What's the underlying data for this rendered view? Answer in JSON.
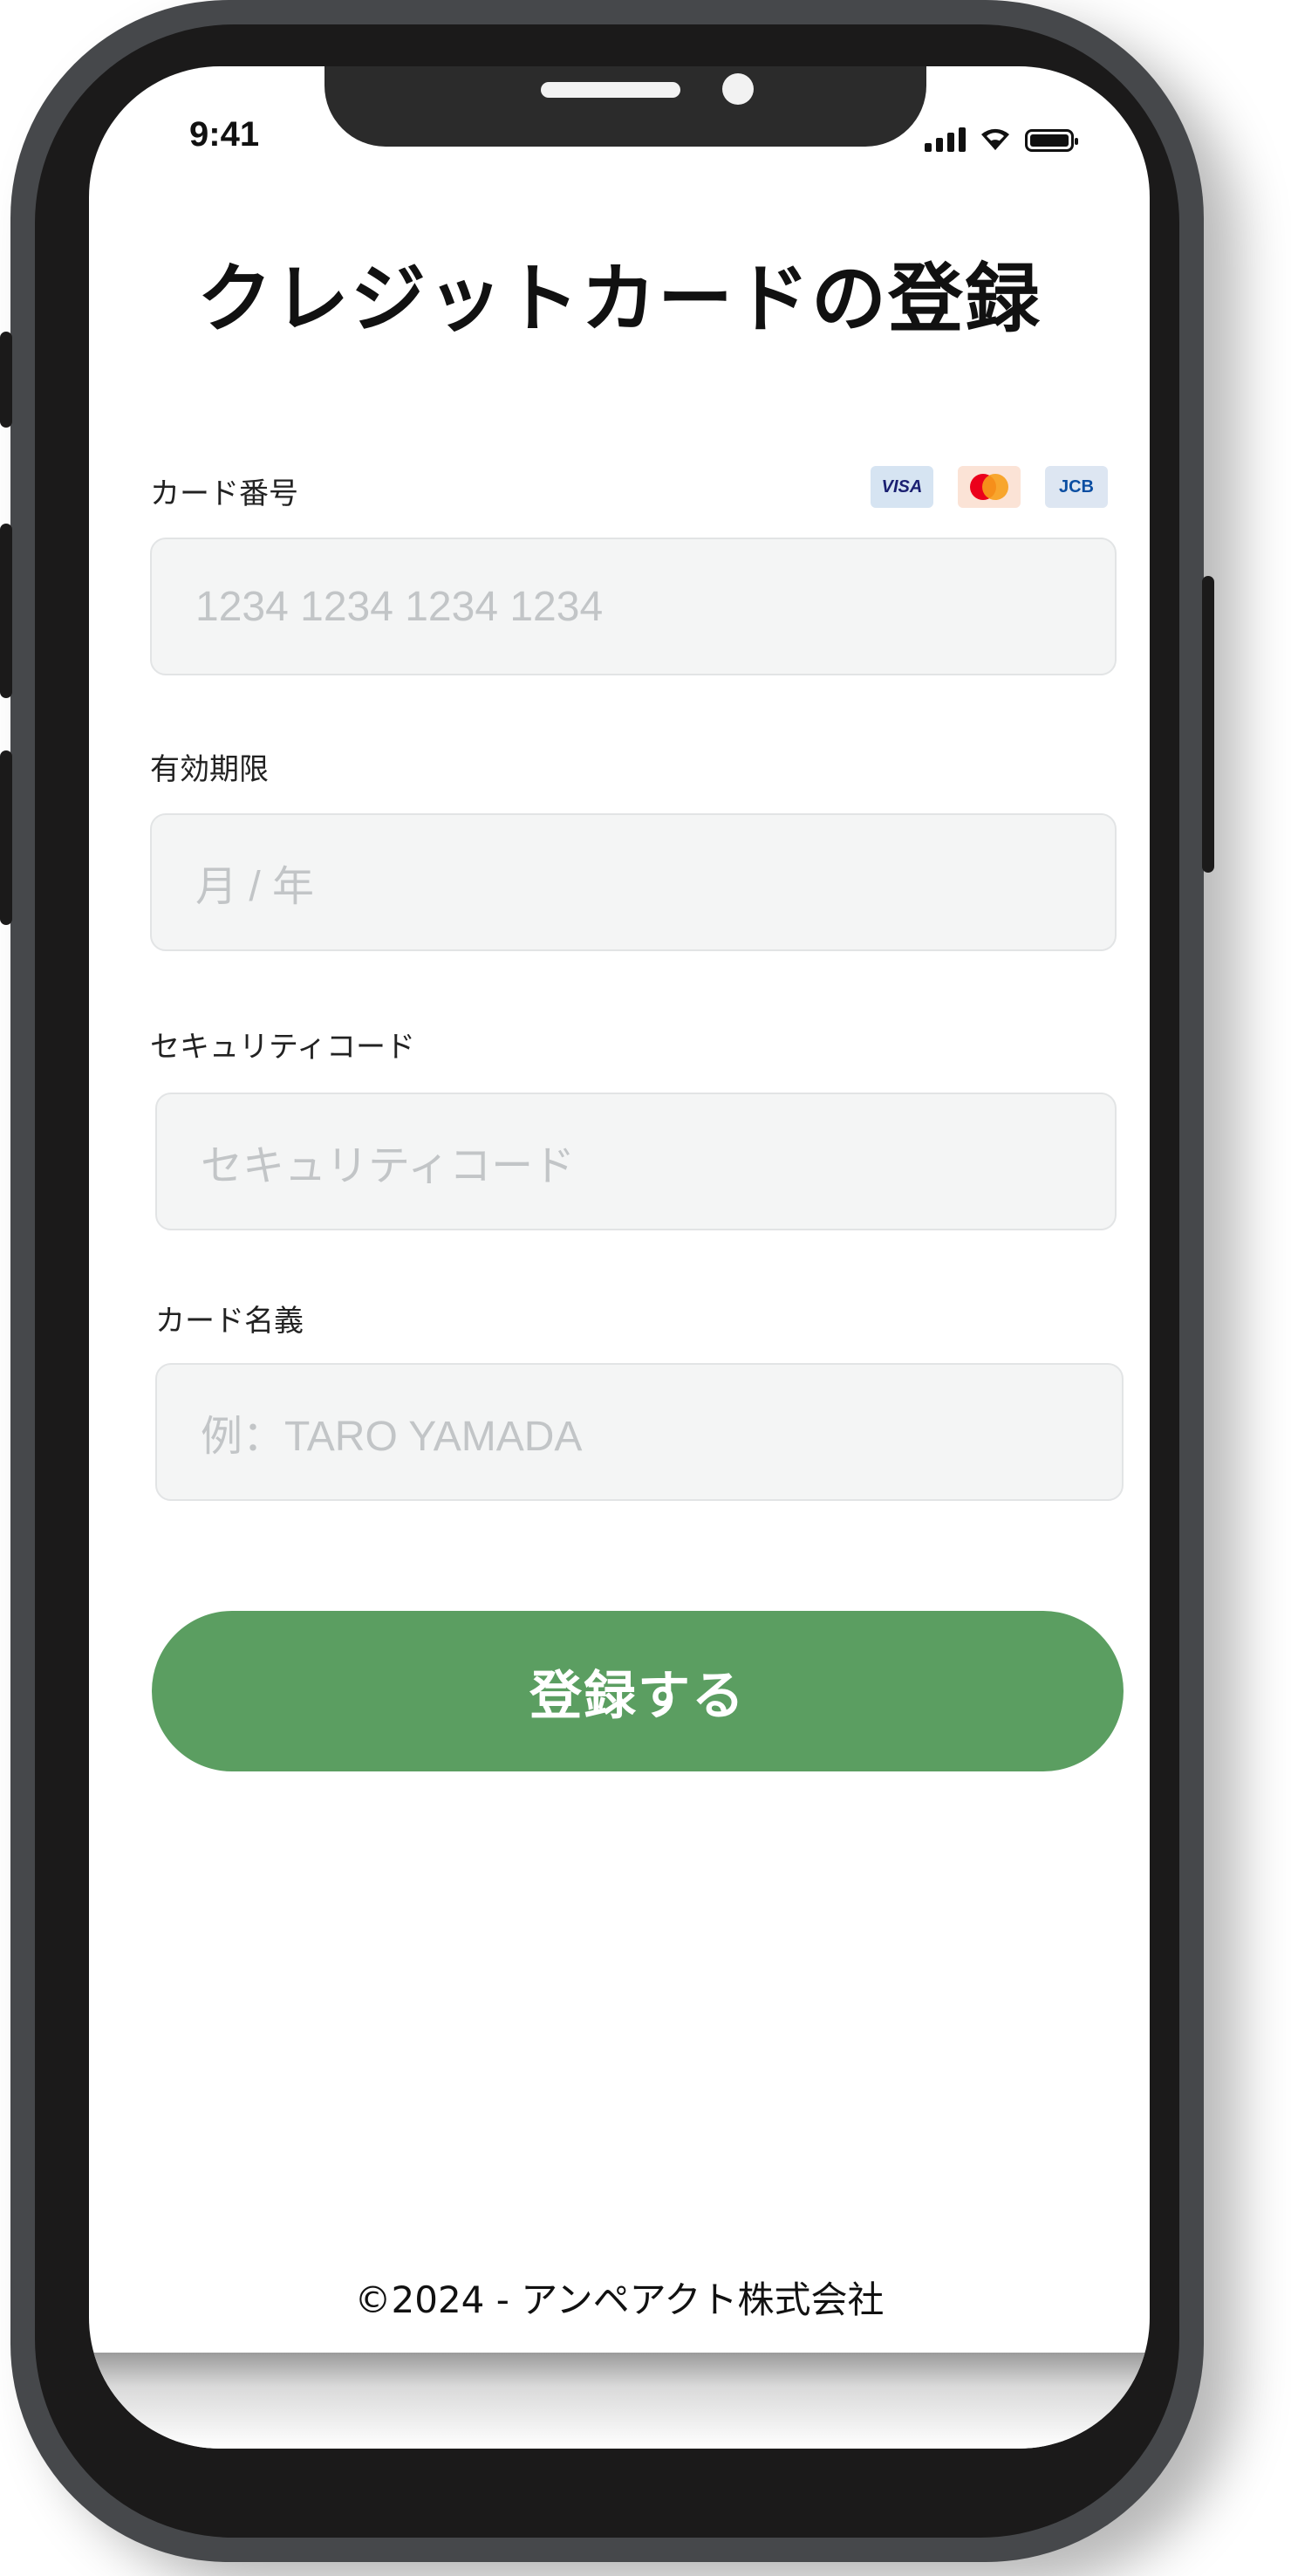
{
  "status_bar": {
    "time": "9:41"
  },
  "page": {
    "title": "クレジットカードの登録"
  },
  "form": {
    "card_number": {
      "label": "カード番号",
      "placeholder": "1234 1234 1234 1234"
    },
    "brands": [
      {
        "name": "visa-logo",
        "text": "VISA",
        "color": "#1a1f71"
      },
      {
        "name": "mastercard-logo",
        "text": "",
        "color": "#eb001b"
      },
      {
        "name": "jcb-logo",
        "text": "JCB",
        "color": "#0b4ea2"
      }
    ],
    "expiry": {
      "label": "有効期限",
      "placeholder": "月 / 年"
    },
    "security_code": {
      "label": "セキュリティコード",
      "placeholder": "セキュリティコード"
    },
    "card_holder": {
      "label": "カード名義",
      "placeholder": "例：TARO YAMADA"
    },
    "submit_label": "登録する"
  },
  "footer": {
    "text": "©2024 - アンペアクト株式会社"
  },
  "colors": {
    "accent": "#5b9e61",
    "input_bg": "#f4f5f5",
    "phone_frame": "#46484b"
  }
}
